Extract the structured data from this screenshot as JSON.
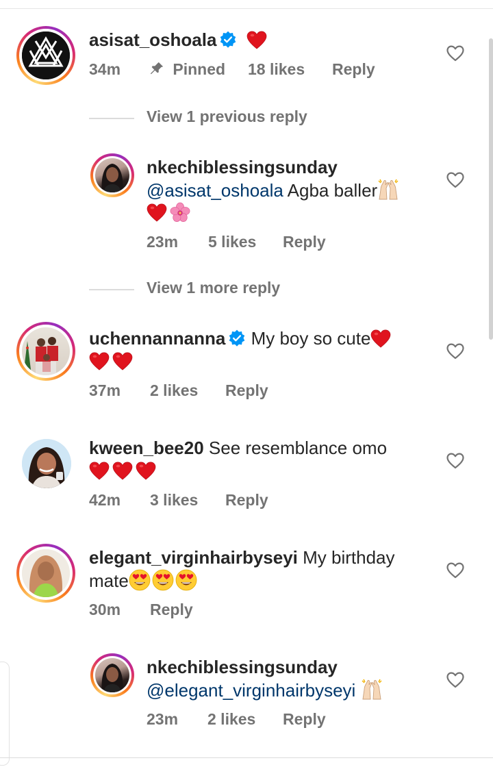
{
  "comments": [
    {
      "username": "asisat_oshoala",
      "verified": true,
      "text": "",
      "mention": "",
      "trailing_emojis": [
        "red-heart"
      ],
      "time": "34m",
      "pinned_label": "Pinned",
      "likes": "18 likes",
      "reply_label": "Reply"
    },
    {
      "username": "nkechiblessingsunday",
      "verified": false,
      "mention": "@asisat_oshoala",
      "text": "Agba baller",
      "trailing_emojis": [
        "raising-hands",
        "red-heart",
        "hibiscus"
      ],
      "time": "23m",
      "likes": "5 likes",
      "reply_label": "Reply"
    },
    {
      "username": "uchennannanna",
      "verified": true,
      "text": "My boy so cute",
      "trailing_emojis": [
        "red-heart",
        "red-heart",
        "red-heart"
      ],
      "time": "37m",
      "likes": "2 likes",
      "reply_label": "Reply"
    },
    {
      "username": "kween_bee20",
      "verified": false,
      "text": "See resemblance omo",
      "trailing_emojis": [
        "red-heart",
        "red-heart",
        "red-heart"
      ],
      "time": "42m",
      "likes": "3 likes",
      "reply_label": "Reply"
    },
    {
      "username": "elegant_virginhairbyseyi",
      "verified": false,
      "text": "My birthday",
      "text_line2": "mate",
      "trailing_emojis": [
        "heart-eyes",
        "heart-eyes",
        "heart-eyes"
      ],
      "time": "30m",
      "reply_label": "Reply"
    },
    {
      "username": "nkechiblessingsunday",
      "verified": false,
      "mention": "@elegant_virginhairbyseyi",
      "text": "",
      "trailing_emojis": [
        "raising-hands"
      ],
      "time": "23m",
      "likes": "2 likes",
      "reply_label": "Reply"
    }
  ],
  "view_replies": {
    "previous": "View 1 previous reply",
    "more": "View 1 more reply"
  },
  "colors": {
    "text": "#262626",
    "meta": "#737373",
    "mention": "#00376b",
    "verified": "#0095f6",
    "heart": "#ed1c24"
  }
}
